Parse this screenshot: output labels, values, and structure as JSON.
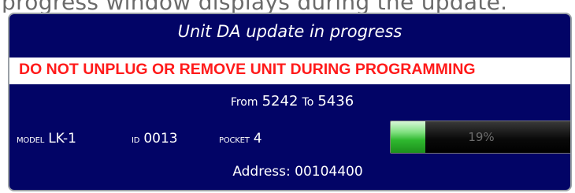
{
  "caption": "progress window displays during the update.",
  "window": {
    "title": "Unit DA update in progress",
    "warning": "DO NOT UNPLUG OR REMOVE UNIT DURING PROGRAMMING",
    "version": {
      "from_label": "From",
      "from_value": "5242",
      "to_label": "To",
      "to_value": "5436"
    },
    "model": {
      "label": "MODEL",
      "value": "LK-1"
    },
    "id": {
      "label": "ID",
      "value": "0013"
    },
    "pocket": {
      "label": "POCKET",
      "value": "4"
    },
    "progress": {
      "percent": 19,
      "text": "19%"
    },
    "address": "Address: 00104400"
  },
  "colors": {
    "window_background": "#020466",
    "warning_text": "#ff1a1a",
    "progress_fill": "#2fb82f"
  }
}
